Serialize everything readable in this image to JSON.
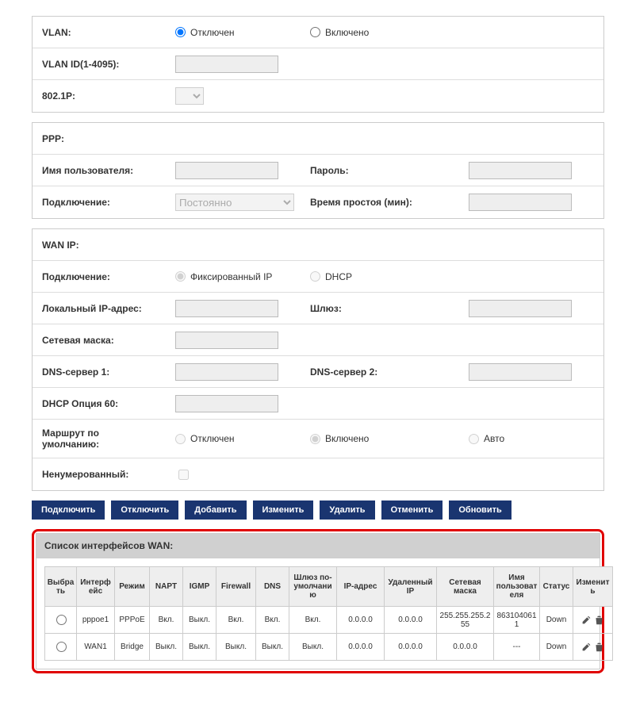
{
  "vlan": {
    "label": "VLAN:",
    "off": "Отключен",
    "on": "Включено",
    "id_label": "VLAN ID(1-4095):",
    "p_label": "802.1P:"
  },
  "ppp": {
    "label": "PPP:",
    "user_label": "Имя пользователя:",
    "pass_label": "Пароль:",
    "conn_label": "Подключение:",
    "conn_value": "Постоянно",
    "idle_label": "Время простоя (мин):"
  },
  "wanip": {
    "label": "WAN IP:",
    "conn_label": "Подключение:",
    "fixed": "Фиксированный IP",
    "dhcp": "DHCP",
    "local_ip_label": "Локальный IP-адрес:",
    "gateway_label": "Шлюз:",
    "mask_label": "Сетевая маска:",
    "dns1_label": "DNS-сервер 1:",
    "dns2_label": "DNS-сервер 2:",
    "dhcp60_label": "DHCP Опция 60:",
    "route_label": "Маршрут по умолчанию:",
    "route_off": "Отключен",
    "route_on": "Включено",
    "route_auto": "Авто",
    "unnum_label": "Ненумерованный:"
  },
  "buttons": {
    "connect": "Подключить",
    "disconnect": "Отключить",
    "add": "Добавить",
    "edit": "Изменить",
    "delete": "Удалить",
    "cancel": "Отменить",
    "refresh": "Обновить"
  },
  "list": {
    "title": "Список интерфейсов WAN:",
    "headers": {
      "select": "Выбрать",
      "iface": "Интерфейс",
      "mode": "Режим",
      "napt": "NAPT",
      "igmp": "IGMP",
      "firewall": "Firewall",
      "dns": "DNS",
      "gw": "Шлюз по-умолчанию",
      "ip": "IP-адрес",
      "remote": "Удаленный IP",
      "mask": "Сетевая маска",
      "user": "Имя пользователя",
      "status": "Статус",
      "edit": "Изменить"
    },
    "rows": [
      {
        "iface": "pppoe1",
        "mode": "PPPoE",
        "napt": "Вкл.",
        "igmp": "Выкл.",
        "firewall": "Вкл.",
        "dns": "Вкл.",
        "gw": "Вкл.",
        "ip": "0.0.0.0",
        "remote": "0.0.0.0",
        "mask": "255.255.255.255",
        "user": "8631040611",
        "status": "Down"
      },
      {
        "iface": "WAN1",
        "mode": "Bridge",
        "napt": "Выкл.",
        "igmp": "Выкл.",
        "firewall": "Выкл.",
        "dns": "Выкл.",
        "gw": "Выкл.",
        "ip": "0.0.0.0",
        "remote": "0.0.0.0",
        "mask": "0.0.0.0",
        "user": "---",
        "status": "Down"
      }
    ]
  }
}
